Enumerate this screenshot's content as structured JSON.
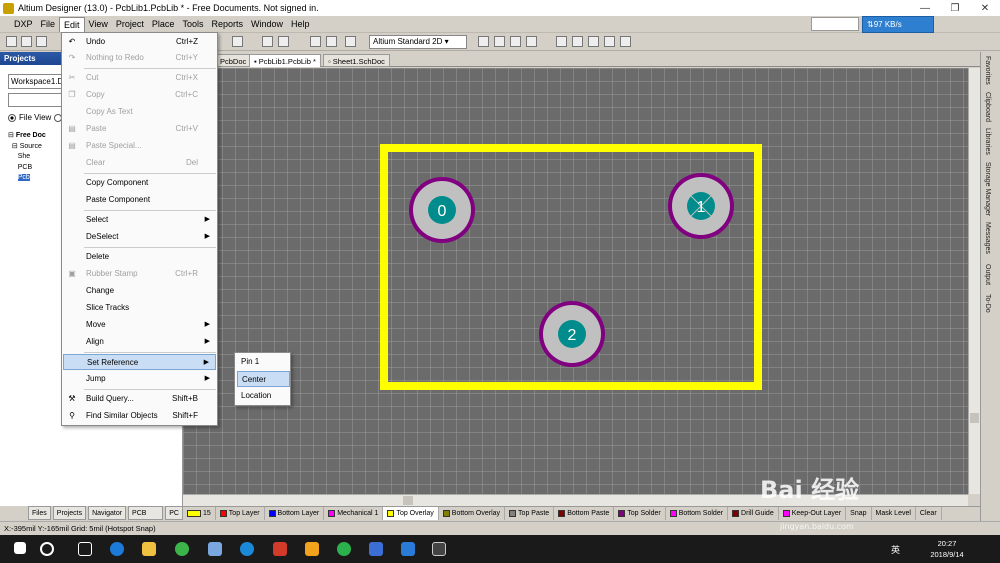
{
  "window": {
    "title": "Altium Designer (13.0) - PcbLib1.PcbLib * - Free Documents. Not signed in.",
    "minimize": "—",
    "maximize": "❐",
    "close": "✕"
  },
  "menubar": [
    "DXP",
    "File",
    "Edit",
    "View",
    "Project",
    "Place",
    "Tools",
    "Reports",
    "Window",
    "Help"
  ],
  "network": {
    "speed": "97 KB/s"
  },
  "toolbar": {
    "view_mode": "Altium Standard 2D"
  },
  "projects_panel": {
    "title": "Projects",
    "workspace": "Workspace1.Ds",
    "file_view": "File View",
    "tree": [
      "Free Doc",
      "Source",
      "She",
      "PCB",
      "Pcb"
    ]
  },
  "panel_tabs": [
    "Files",
    "Projects",
    "Navigator",
    "PCB Library",
    "PC"
  ],
  "doc_tabs": [
    "PcbDoc",
    "PcbLib1.PcbLib *",
    "Sheet1.SchDoc"
  ],
  "pads": [
    {
      "label": "0"
    },
    {
      "label": "1"
    },
    {
      "label": "2"
    }
  ],
  "edit_menu": [
    {
      "label": "Undo",
      "shortcut": "Ctrl+Z",
      "enabled": true
    },
    {
      "label": "Nothing to Redo",
      "shortcut": "Ctrl+Y",
      "enabled": false
    },
    {
      "label": "Cut",
      "shortcut": "Ctrl+X",
      "enabled": false
    },
    {
      "label": "Copy",
      "shortcut": "Ctrl+C",
      "enabled": false
    },
    {
      "label": "Copy As Text",
      "shortcut": "",
      "enabled": false
    },
    {
      "label": "Paste",
      "shortcut": "Ctrl+V",
      "enabled": false
    },
    {
      "label": "Paste Special...",
      "shortcut": "",
      "enabled": false
    },
    {
      "label": "Clear",
      "shortcut": "Del",
      "enabled": false
    },
    {
      "label": "Copy Component",
      "shortcut": "",
      "enabled": true
    },
    {
      "label": "Paste Component",
      "shortcut": "",
      "enabled": true
    },
    {
      "label": "Select",
      "shortcut": "",
      "enabled": true
    },
    {
      "label": "DeSelect",
      "shortcut": "",
      "enabled": true
    },
    {
      "label": "Delete",
      "shortcut": "",
      "enabled": true
    },
    {
      "label": "Rubber Stamp",
      "shortcut": "Ctrl+R",
      "enabled": false
    },
    {
      "label": "Change",
      "shortcut": "",
      "enabled": true
    },
    {
      "label": "Slice Tracks",
      "shortcut": "",
      "enabled": true
    },
    {
      "label": "Move",
      "shortcut": "",
      "enabled": true
    },
    {
      "label": "Align",
      "shortcut": "",
      "enabled": true
    },
    {
      "label": "Set Reference",
      "shortcut": "",
      "enabled": true
    },
    {
      "label": "Jump",
      "shortcut": "",
      "enabled": true
    },
    {
      "label": "Build Query...",
      "shortcut": "Shift+B",
      "enabled": true
    },
    {
      "label": "Find Similar Objects",
      "shortcut": "Shift+F",
      "enabled": true
    }
  ],
  "set_reference_submenu": [
    "Pin 1",
    "Center",
    "Location"
  ],
  "right_dock": [
    "Favorites",
    "Clipboard",
    "Libraries",
    "Storage Manager",
    "Messages",
    "Output",
    "To-Do"
  ],
  "layers": {
    "current_value": "15",
    "items": [
      {
        "name": "Top Layer",
        "color": "#ff0000"
      },
      {
        "name": "Bottom Layer",
        "color": "#0000ff"
      },
      {
        "name": "Mechanical 1",
        "color": "#ff00ff"
      },
      {
        "name": "Top Overlay",
        "color": "#ffff00"
      },
      {
        "name": "Bottom Overlay",
        "color": "#808000"
      },
      {
        "name": "Top Paste",
        "color": "#808080"
      },
      {
        "name": "Bottom Paste",
        "color": "#800000"
      },
      {
        "name": "Top Solder",
        "color": "#800080"
      },
      {
        "name": "Bottom Solder",
        "color": "#ff00ff"
      },
      {
        "name": "Drill Guide",
        "color": "#800000"
      },
      {
        "name": "Keep-Out Layer",
        "color": "#ff00ff"
      }
    ],
    "snap": "Snap",
    "mask_level": "Mask Level",
    "clear": "Clear"
  },
  "status": {
    "text": "X:-395mil Y:-165mil   Grid: 5mil      (Hotspot Snap)"
  },
  "taskbar": {
    "time": "20:27",
    "date": "2018/9/14",
    "ime": "英"
  },
  "watermark": {
    "text": "Bai 经验",
    "sub": "jingyan.baidu.com"
  }
}
